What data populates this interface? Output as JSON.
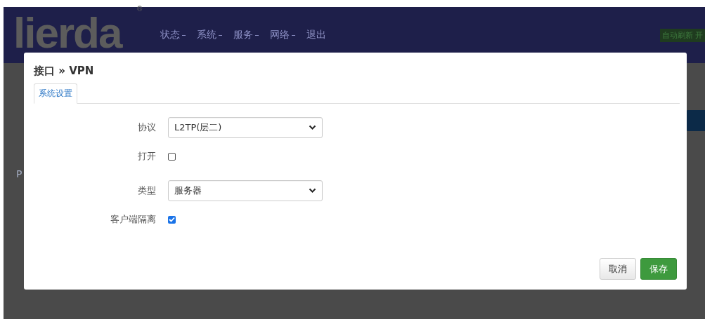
{
  "header": {
    "logo": "lierda",
    "logo_mark": "®",
    "nav": [
      {
        "label": "状态",
        "dropdown": true
      },
      {
        "label": "系统",
        "dropdown": true
      },
      {
        "label": "服务",
        "dropdown": true
      },
      {
        "label": "网络",
        "dropdown": true
      },
      {
        "label": "退出",
        "dropdown": false
      }
    ],
    "badge": "自动刷新 开"
  },
  "background": {
    "text": "P"
  },
  "dialog": {
    "title": "接口 » VPN",
    "tabs": [
      {
        "label": "系统设置",
        "selected": true
      }
    ],
    "fields": [
      {
        "kind": "select",
        "label": "协议",
        "value": "L2TP(层二)"
      },
      {
        "kind": "checkbox",
        "label": "打开",
        "checked": false
      },
      {
        "kind": "select",
        "label": "类型",
        "value": "服务器"
      },
      {
        "kind": "checkbox",
        "label": "客户端隔离",
        "checked": true
      }
    ],
    "buttons": [
      {
        "kind": "cancel",
        "label": "取消"
      },
      {
        "kind": "save",
        "label": "保存"
      }
    ]
  }
}
